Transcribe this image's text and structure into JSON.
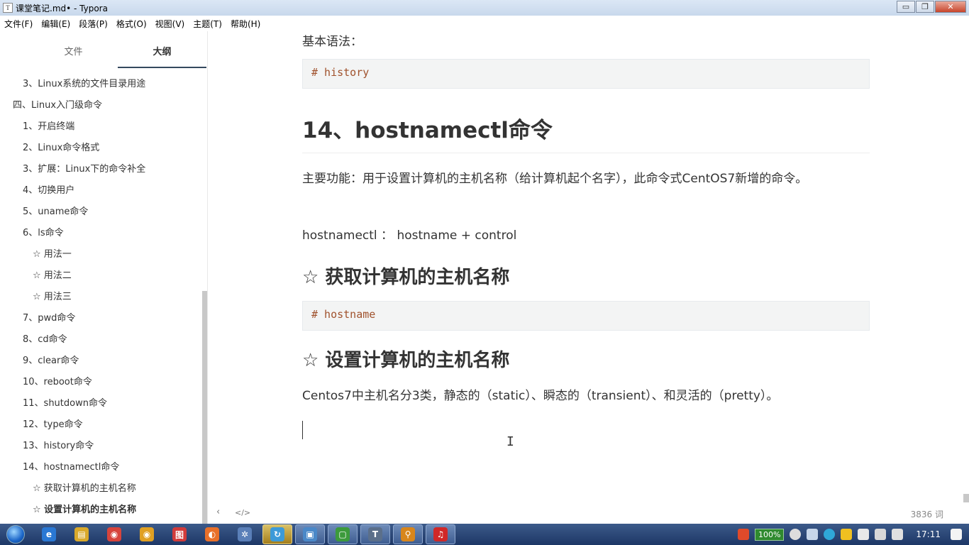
{
  "window": {
    "title": "课堂笔记.md• - Typora",
    "minimize": "▭",
    "maximize": "❐",
    "close": "✕"
  },
  "menu": [
    "文件(F)",
    "编辑(E)",
    "段落(P)",
    "格式(O)",
    "视图(V)",
    "主题(T)",
    "帮助(H)"
  ],
  "sidebar": {
    "tabs": [
      {
        "label": "文件"
      },
      {
        "label": "大纲"
      }
    ],
    "active_tab": "大纲",
    "outline": [
      {
        "label": "3、Linux系统的文件目录用途",
        "level": 2
      },
      {
        "label": "四、Linux入门级命令",
        "level": 1
      },
      {
        "label": "1、开启终端",
        "level": 2
      },
      {
        "label": "2、Linux命令格式",
        "level": 2
      },
      {
        "label": "3、扩展：Linux下的命令补全",
        "level": 2
      },
      {
        "label": "4、切换用户",
        "level": 2
      },
      {
        "label": "5、uname命令",
        "level": 2
      },
      {
        "label": "6、ls命令",
        "level": 2
      },
      {
        "label": "☆ 用法一",
        "level": 3
      },
      {
        "label": "☆ 用法二",
        "level": 3
      },
      {
        "label": "☆ 用法三",
        "level": 3
      },
      {
        "label": "7、pwd命令",
        "level": 2
      },
      {
        "label": "8、cd命令",
        "level": 2
      },
      {
        "label": "9、clear命令",
        "level": 2
      },
      {
        "label": "10、reboot命令",
        "level": 2
      },
      {
        "label": "11、shutdown命令",
        "level": 2
      },
      {
        "label": "12、type命令",
        "level": 2
      },
      {
        "label": "13、history命令",
        "level": 2
      },
      {
        "label": "14、hostnamectl命令",
        "level": 2
      },
      {
        "label": "☆ 获取计算机的主机名称",
        "level": 3
      },
      {
        "label": "☆ 设置计算机的主机名称",
        "level": 3,
        "active": true
      }
    ]
  },
  "editor": {
    "basic_syntax": "基本语法：",
    "code_history": "# history",
    "heading_14": "14、hostnamectl命令",
    "func_desc": "主要功能：用于设置计算机的主机名称（给计算机起个名字），此命令式CentOS7新增的命令。",
    "hostnamectl_line": "hostnamectl  ：  hostname + control",
    "heading_get": "☆ 获取计算机的主机名称",
    "code_hostname": "# hostname",
    "heading_set": "☆ 设置计算机的主机名称",
    "centos_desc": "Centos7中主机名分3类，静态的（static）、瞬态的（transient）、和灵活的（pretty）。",
    "ibeam": "I"
  },
  "footer": {
    "back": "‹",
    "source": "</>",
    "word_count": "3836 词"
  },
  "taskbar": {
    "apps": [
      {
        "name": "ie-icon",
        "glyph": "e",
        "color": "#2a78d4",
        "state": ""
      },
      {
        "name": "explorer-icon",
        "glyph": "▤",
        "color": "#d9a92b",
        "state": ""
      },
      {
        "name": "chrome-icon",
        "glyph": "◉",
        "color": "#d7443c",
        "state": ""
      },
      {
        "name": "chrome-icon-2",
        "glyph": "◉",
        "color": "#e0a022",
        "state": ""
      },
      {
        "name": "app-red-icon",
        "glyph": "图",
        "color": "#d23b3b",
        "state": ""
      },
      {
        "name": "firefox-icon",
        "glyph": "◐",
        "color": "#e8702a",
        "state": ""
      },
      {
        "name": "app-tool-icon",
        "glyph": "✲",
        "color": "#5a7fb8",
        "state": ""
      },
      {
        "name": "app-active-icon",
        "glyph": "↻",
        "color": "#3d9ad8",
        "state": "active"
      },
      {
        "name": "remote-icon",
        "glyph": "▣",
        "color": "#4a88c8",
        "state": "running"
      },
      {
        "name": "vm-icon",
        "glyph": "▢",
        "color": "#3c9a3c",
        "state": "running"
      },
      {
        "name": "typora-icon",
        "glyph": "T",
        "color": "#5b6f8a",
        "state": "running"
      },
      {
        "name": "search-icon",
        "glyph": "⚲",
        "color": "#d8861c",
        "state": "running"
      },
      {
        "name": "music-icon",
        "glyph": "♫",
        "color": "#d02828",
        "state": "running"
      }
    ],
    "tray_percent": "100%",
    "clock": "17:11"
  },
  "colors": {
    "code_text": "#a0522d",
    "heading": "#333333",
    "taskbar": "#1d3766"
  }
}
